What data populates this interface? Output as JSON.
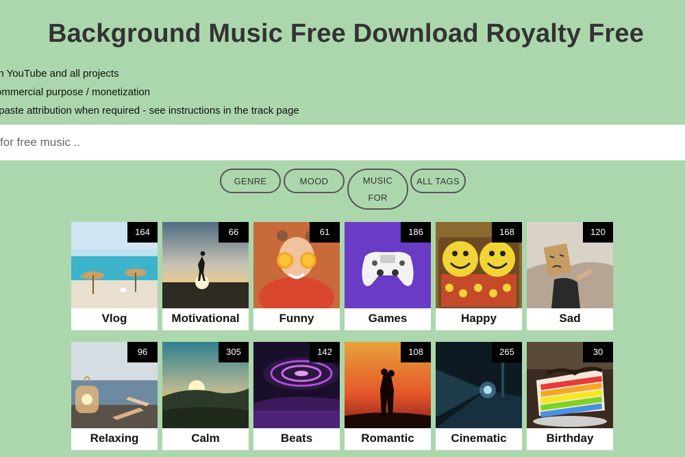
{
  "header": {
    "title": "Background Music Free Download Royalty Free",
    "features": [
      "in YouTube and all projects",
      "ommercial purpose / monetization",
      "/paste attribution when required - see instructions in the track page"
    ]
  },
  "search": {
    "placeholder": "for free music .."
  },
  "tabs": [
    {
      "label": "GENRE"
    },
    {
      "label": "MOOD"
    },
    {
      "label": "MUSIC FOR"
    },
    {
      "label": "ALL TAGS"
    }
  ],
  "categories": [
    {
      "label": "Vlog",
      "count": "164"
    },
    {
      "label": "Motivational",
      "count": "66"
    },
    {
      "label": "Funny",
      "count": "61"
    },
    {
      "label": "Games",
      "count": "186"
    },
    {
      "label": "Happy",
      "count": "168"
    },
    {
      "label": "Sad",
      "count": "120"
    },
    {
      "label": "Relaxing",
      "count": "96"
    },
    {
      "label": "Calm",
      "count": "305"
    },
    {
      "label": "Beats",
      "count": "142"
    },
    {
      "label": "Romantic",
      "count": "108"
    },
    {
      "label": "Cinematic",
      "count": "265"
    },
    {
      "label": "Birthday",
      "count": "30"
    }
  ],
  "colors": {
    "background": "#acd7ad",
    "badge": "#000000",
    "tab_border": "#555555"
  }
}
